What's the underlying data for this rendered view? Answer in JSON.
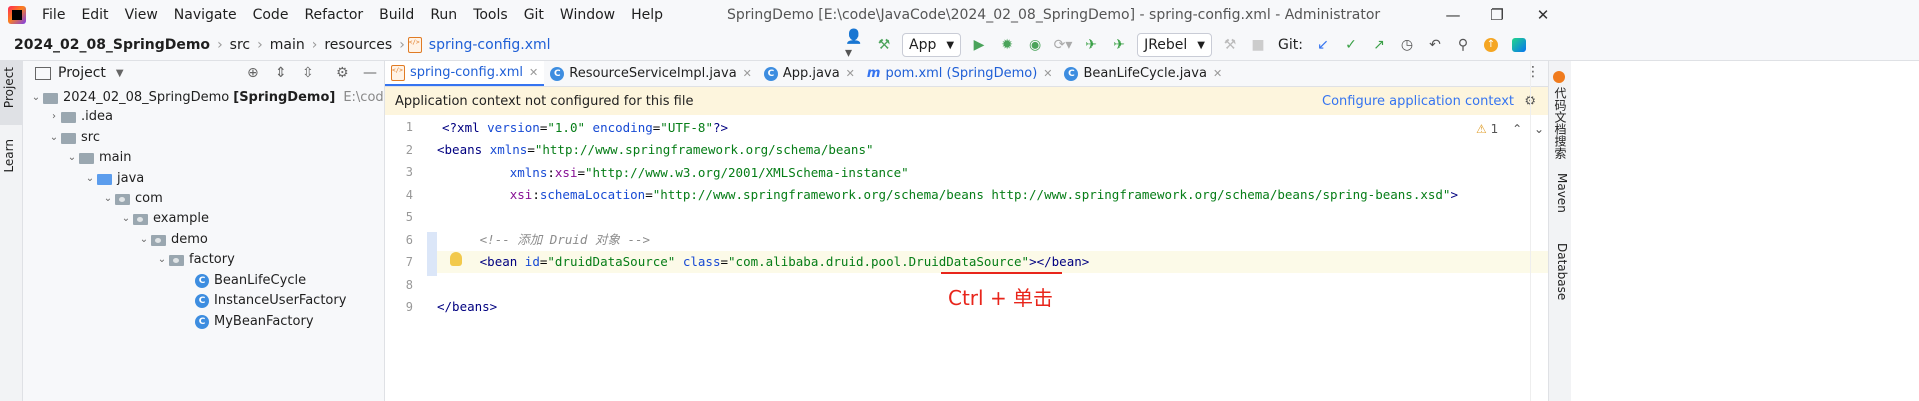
{
  "window": {
    "title": "SpringDemo [E:\\code\\JavaCode\\2024_02_08_SpringDemo] - spring-config.xml - Administrator",
    "minimize": "—",
    "maximize": "❐",
    "close": "✕"
  },
  "menu": [
    "File",
    "Edit",
    "View",
    "Navigate",
    "Code",
    "Refactor",
    "Build",
    "Run",
    "Tools",
    "Git",
    "Window",
    "Help"
  ],
  "breadcrumb": [
    "2024_02_08_SpringDemo",
    "src",
    "main",
    "resources",
    "spring-config.xml"
  ],
  "toolbar": {
    "run_config": "App",
    "jrebel": "JRebel",
    "git_label": "Git:"
  },
  "project_panel": {
    "title": "Project",
    "tree": [
      {
        "label": "2024_02_08_SpringDemo",
        "suffix": "[SpringDemo]",
        "path": "E:\\code\\Java"
      },
      {
        "label": ".idea"
      },
      {
        "label": "src"
      },
      {
        "label": "main"
      },
      {
        "label": "java"
      },
      {
        "label": "com"
      },
      {
        "label": "example"
      },
      {
        "label": "demo"
      },
      {
        "label": "factory"
      },
      {
        "label": "BeanLifeCycle"
      },
      {
        "label": "InstanceUserFactory"
      },
      {
        "label": "MyBeanFactory"
      }
    ]
  },
  "side_tabs": {
    "left": [
      "Project",
      "Learn"
    ],
    "right": [
      "代码文档搜索",
      "Maven",
      "Database"
    ]
  },
  "editor_tabs": [
    {
      "label": "spring-config.xml",
      "active": true
    },
    {
      "label": "ResourceServiceImpl.java"
    },
    {
      "label": "App.java"
    },
    {
      "label": "pom.xml (SpringDemo)"
    },
    {
      "label": "BeanLifeCycle.java"
    }
  ],
  "banner": {
    "text": "Application context not configured for this file",
    "link": "Configure application context"
  },
  "inspection": {
    "warnings": "1"
  },
  "code": {
    "line_numbers": [
      "1",
      "2",
      "3",
      "4",
      "5",
      "6",
      "7",
      "8",
      "9"
    ],
    "l1": {
      "a": "<?xml ",
      "b": "version",
      "c": "=",
      "d": "\"1.0\"",
      "e": " ",
      "f": "encoding",
      "g": "=",
      "h": "\"UTF-8\"",
      "i": "?>"
    },
    "l2": {
      "a": "<beans ",
      "b": "xmlns",
      "c": "=",
      "d": "\"http://www.springframework.org/schema/beans\""
    },
    "l3": {
      "indent": "         ",
      "a": "xmlns",
      "b": ":",
      "c": "xsi",
      "d": "=",
      "e": "\"http://www.w3.org/2001/XMLSchema-instance\""
    },
    "l4": {
      "indent": "         ",
      "a": "xsi",
      "b": ":",
      "c": "schemaLocation",
      "d": "=",
      "e": "\"http://www.springframework.org/schema/beans http://www.springframework.org/schema/beans/spring-beans.xsd\"",
      "f": ">"
    },
    "l6": {
      "indent": "     ",
      "comment": "<!-- 添加 Druid 对象 -->"
    },
    "l7": {
      "indent": "     ",
      "a": "<bean ",
      "b": "id",
      "c": "=",
      "d": "\"druidDataSource\"",
      "e": " ",
      "f": "class",
      "g": "=",
      "h": "\"com.alibaba.druid.pool.",
      "i": "DruidDataSource",
      "j": "\"",
      "k": "></bean>"
    },
    "l9": {
      "a": "</beans>"
    }
  },
  "annotation": "Ctrl + 单击"
}
